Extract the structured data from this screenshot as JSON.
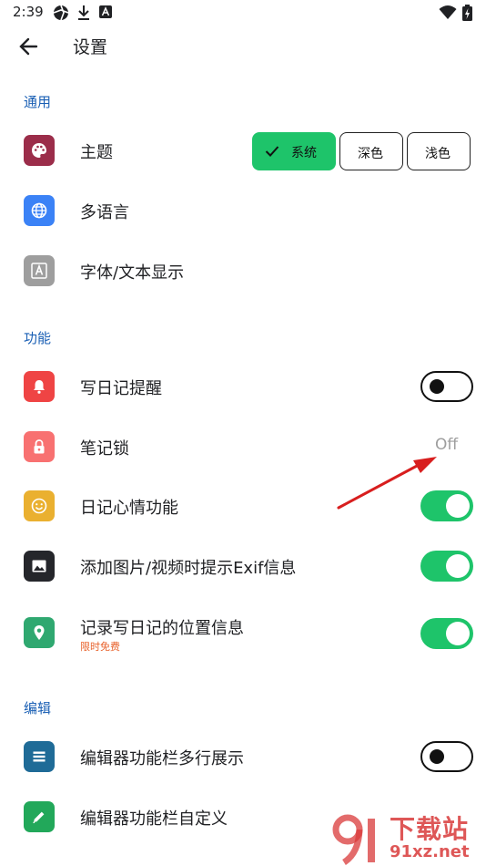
{
  "status_bar": {
    "time": "2:39"
  },
  "header": {
    "title": "设置"
  },
  "sections": {
    "general": "通用",
    "features": "功能",
    "editor": "编辑"
  },
  "theme": {
    "label": "主题",
    "options": [
      "系统",
      "深色",
      "浅色"
    ],
    "selected": "系统"
  },
  "rows": {
    "language": "多语言",
    "font": "字体/文本显示",
    "reminder": "写日记提醒",
    "lock": "笔记锁",
    "lock_value": "Off",
    "mood": "日记心情功能",
    "exif": "添加图片/视频时提示Exif信息",
    "location": "记录写日记的位置信息",
    "location_badge": "限时免费",
    "multiline": "编辑器功能栏多行展示",
    "custom": "编辑器功能栏自定义"
  },
  "toggles": {
    "reminder": false,
    "mood": true,
    "exif": true,
    "location": true,
    "multiline": false
  },
  "watermark": {
    "brand": "下载站",
    "site": "91xz.net"
  },
  "colors": {
    "accent": "#1ec46a",
    "section": "#1a5fb4",
    "theme_icon": "#9b2d4a",
    "language_icon": "#3b82f6",
    "font_icon": "#9e9e9e",
    "reminder_icon": "#ef4444",
    "lock_icon": "#f87171",
    "mood_icon": "#eab030",
    "exif_icon": "#25262b",
    "location_icon": "#2fa870",
    "multiline_icon": "#1f6b97",
    "custom_icon": "#22a85a"
  },
  "icons": {
    "theme": "palette-icon",
    "language": "globe-icon",
    "font": "font-a-icon",
    "reminder": "bell-icon",
    "lock": "lock-icon",
    "mood": "smiley-icon",
    "exif": "image-icon",
    "location": "location-pin-icon",
    "multiline": "list-icon",
    "custom": "pencil-icon"
  }
}
